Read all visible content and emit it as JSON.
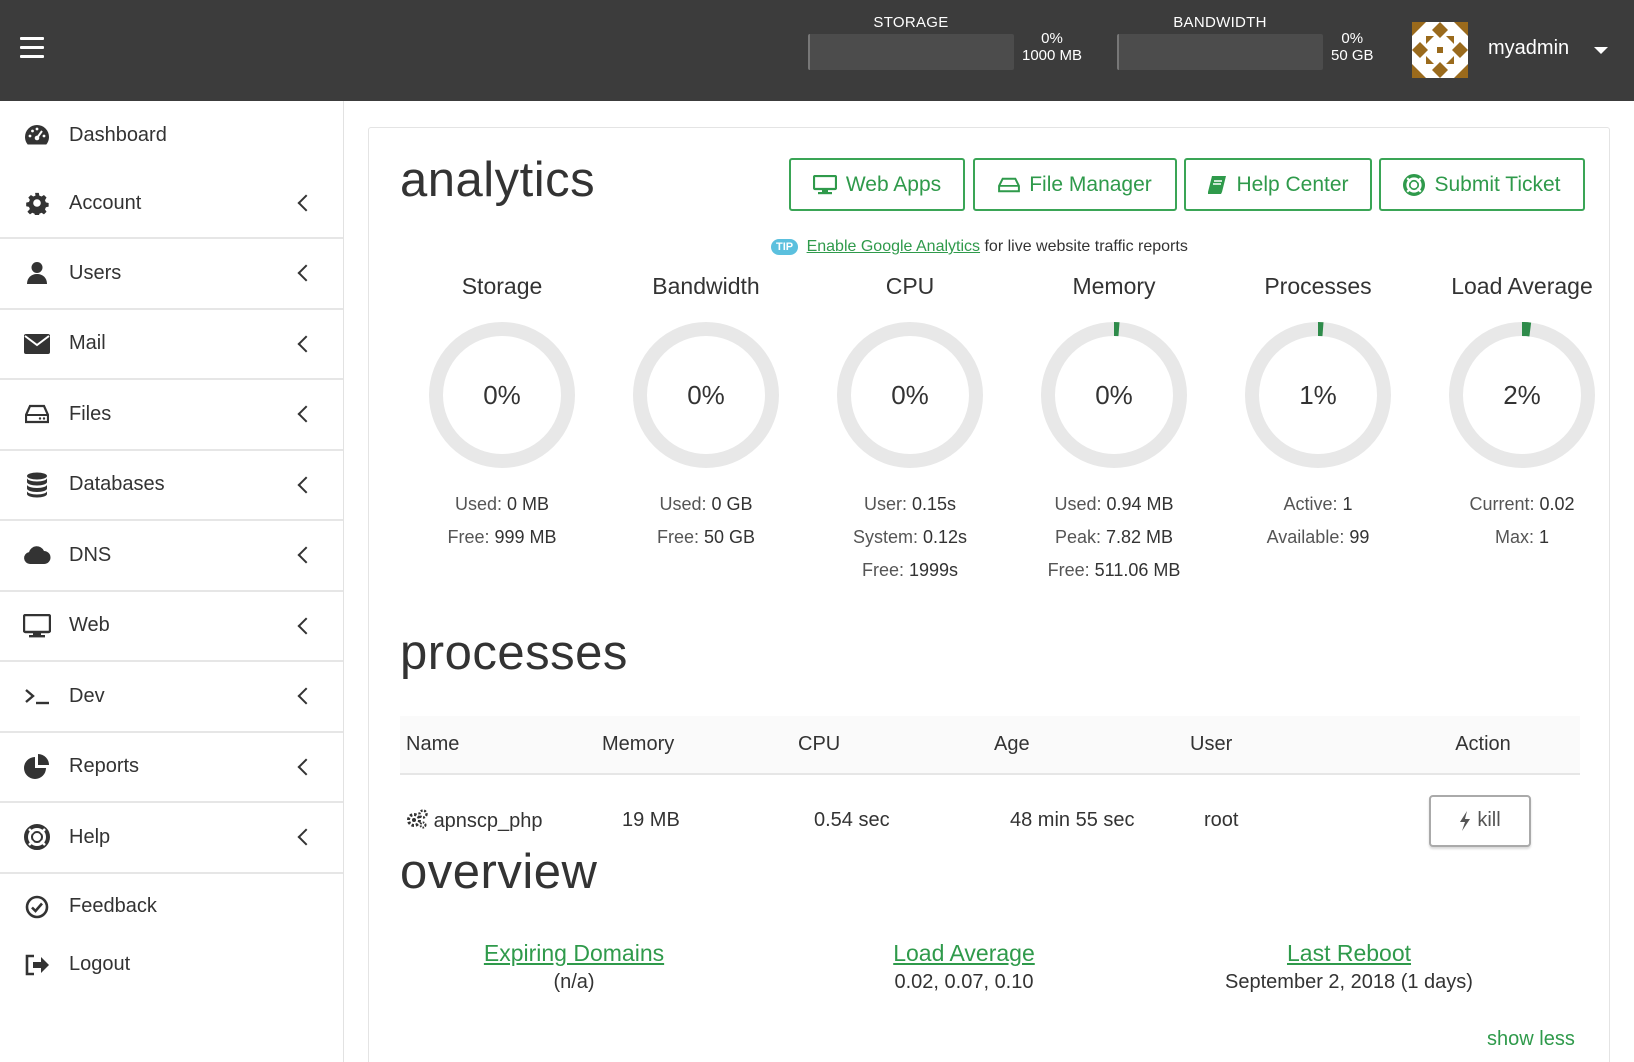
{
  "topbar": {
    "menu_icon": "hamburger-icon",
    "storage": {
      "label": "STORAGE",
      "percent": "0%",
      "total": "1000 MB",
      "fill": 0
    },
    "bandwidth": {
      "label": "BANDWIDTH",
      "percent": "0%",
      "total": "50 GB",
      "fill": 0
    },
    "username": "myadmin"
  },
  "sidebar": {
    "items": [
      {
        "label": "Dashboard",
        "icon": "dashboard-icon",
        "expandable": false
      },
      {
        "label": "Account",
        "icon": "gear-icon",
        "expandable": true
      },
      {
        "label": "Users",
        "icon": "user-icon",
        "expandable": true
      },
      {
        "label": "Mail",
        "icon": "envelope-icon",
        "expandable": true
      },
      {
        "label": "Files",
        "icon": "hard-drive-icon",
        "expandable": true
      },
      {
        "label": "Databases",
        "icon": "database-icon",
        "expandable": true
      },
      {
        "label": "DNS",
        "icon": "cloud-icon",
        "expandable": true
      },
      {
        "label": "Web",
        "icon": "monitor-icon",
        "expandable": true
      },
      {
        "label": "Dev",
        "icon": "terminal-icon",
        "expandable": true
      },
      {
        "label": "Reports",
        "icon": "pie-chart-icon",
        "expandable": true
      },
      {
        "label": "Help",
        "icon": "lifebuoy-icon",
        "expandable": true
      },
      {
        "label": "Feedback",
        "icon": "check-circle-icon",
        "expandable": false
      },
      {
        "label": "Logout",
        "icon": "sign-out-icon",
        "expandable": false
      }
    ]
  },
  "analytics": {
    "title": "analytics",
    "buttons": {
      "web_apps": "Web Apps",
      "file_manager": "File Manager",
      "help_center": "Help Center",
      "submit_ticket": "Submit Ticket"
    },
    "tip": {
      "badge": "TIP",
      "link": "Enable Google Analytics",
      "text": "for live website traffic reports"
    },
    "gauges": [
      {
        "title": "Storage",
        "percent_label": "0%",
        "value": 0,
        "stats": [
          {
            "k": "Used:",
            "v": "0 MB"
          },
          {
            "k": "Free:",
            "v": "999 MB"
          }
        ]
      },
      {
        "title": "Bandwidth",
        "percent_label": "0%",
        "value": 0,
        "stats": [
          {
            "k": "Used:",
            "v": "0 GB"
          },
          {
            "k": "Free:",
            "v": "50 GB"
          }
        ]
      },
      {
        "title": "CPU",
        "percent_label": "0%",
        "value": 0,
        "stats": [
          {
            "k": "User:",
            "v": "0.15s"
          },
          {
            "k": "System:",
            "v": "0.12s"
          },
          {
            "k": "Free:",
            "v": "1999s"
          }
        ]
      },
      {
        "title": "Memory",
        "percent_label": "0%",
        "value": 0.01,
        "stats": [
          {
            "k": "Used:",
            "v": "0.94 MB"
          },
          {
            "k": "Peak:",
            "v": "7.82 MB"
          },
          {
            "k": "Free:",
            "v": "511.06 MB"
          }
        ]
      },
      {
        "title": "Processes",
        "percent_label": "1%",
        "value": 0.01,
        "stats": [
          {
            "k": "Active:",
            "v": "1"
          },
          {
            "k": "Available:",
            "v": "99"
          }
        ]
      },
      {
        "title": "Load Average",
        "percent_label": "2%",
        "value": 0.02,
        "stats": [
          {
            "k": "Current:",
            "v": "0.02"
          },
          {
            "k": "Max:",
            "v": "1"
          }
        ]
      }
    ],
    "gauge_colors": {
      "track": "#e8e8e8",
      "fill": "#2e8b4a"
    }
  },
  "processes": {
    "title": "processes",
    "columns": [
      "Name",
      "Memory",
      "CPU",
      "Age",
      "User",
      "Action"
    ],
    "rows": [
      {
        "name": "apnscp_php",
        "memory": "19 MB",
        "cpu": "0.54 sec",
        "age": "48 min 55 sec",
        "user": "root",
        "action": "kill"
      }
    ]
  },
  "overview": {
    "title": "overview",
    "items": [
      {
        "link": "Expiring Domains",
        "value": "(n/a)"
      },
      {
        "link": "Load Average",
        "value": "0.02, 0.07, 0.10"
      },
      {
        "link": "Last Reboot",
        "value": "September 2, 2018 (1 days)"
      }
    ],
    "show_less": "show less"
  }
}
